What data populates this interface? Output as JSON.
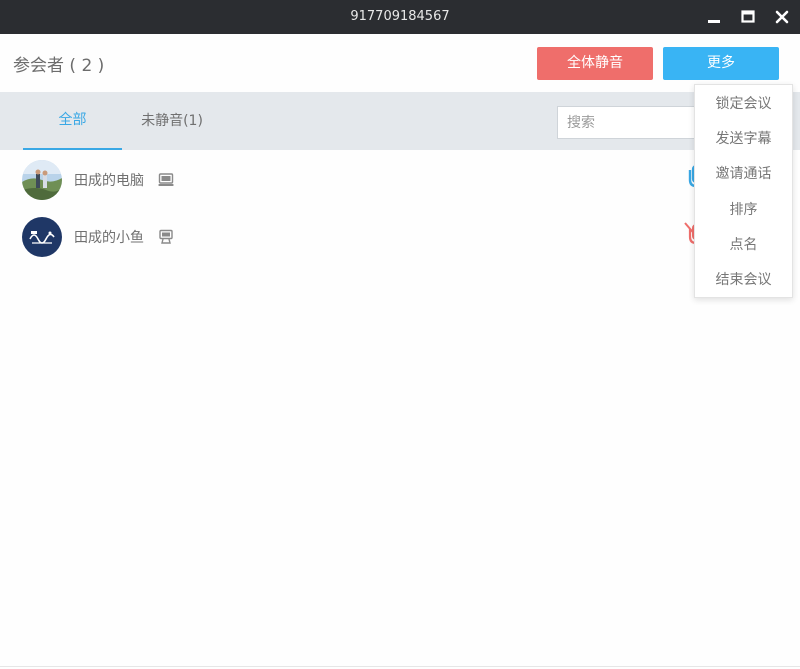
{
  "window": {
    "title": "917709184567"
  },
  "header": {
    "participants_label": "参会者 ( 2 )",
    "mute_all_label": "全体静音",
    "more_label": "更多"
  },
  "tabs": [
    {
      "label": "全部",
      "active": true
    },
    {
      "label": "未静音(1)",
      "active": false
    }
  ],
  "search": {
    "placeholder": "搜索",
    "value": ""
  },
  "participants": [
    {
      "name": "田成的电脑",
      "device": "computer-icon",
      "mic": "mic-on-icon",
      "mic_color": "#3aa8e5"
    },
    {
      "name": "田成的小鱼",
      "device": "video-terminal-icon",
      "mic": "mic-muted-icon",
      "mic_color": "#ef6e6b"
    }
  ],
  "more_menu": {
    "items": [
      "锁定会议",
      "发送字幕",
      "邀请通话",
      "排序",
      "点名",
      "结束会议"
    ]
  },
  "colors": {
    "titlebar": "#2b2d31",
    "accent": "#39b4f4",
    "danger": "#ef6e6b",
    "tabbar": "#e4e8ec"
  }
}
